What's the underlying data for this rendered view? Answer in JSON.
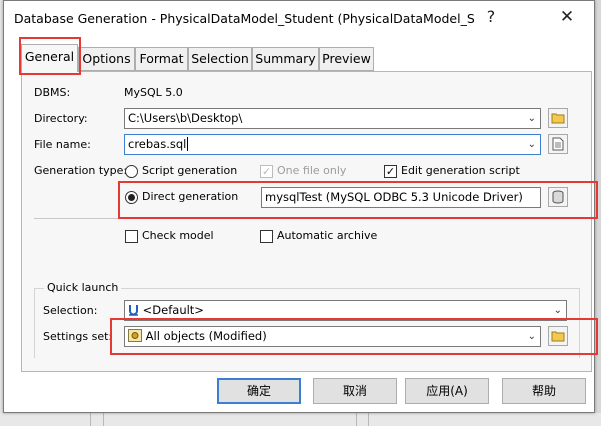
{
  "window": {
    "title": "Database Generation - PhysicalDataModel_Student (PhysicalDataModel_St...",
    "help_symbol": "?",
    "close_symbol": "✕"
  },
  "tabs": [
    {
      "label": "General",
      "active": true
    },
    {
      "label": "Options"
    },
    {
      "label": "Format"
    },
    {
      "label": "Selection"
    },
    {
      "label": "Summary"
    },
    {
      "label": "Preview"
    }
  ],
  "general": {
    "dbms_label": "DBMS:",
    "dbms_value": "MySQL 5.0",
    "directory_label": "Directory:",
    "directory_value": "C:\\Users\\b\\Desktop\\",
    "filename_label": "File name:",
    "filename_value": "crebas.sql",
    "gentype_label": "Generation type:",
    "script_generation": "Script generation",
    "one_file_only": "One file only",
    "edit_generation_script": "Edit generation script",
    "direct_generation": "Direct generation",
    "datasource_value": "mysqlTest (MySQL ODBC 5.3 Unicode Driver)",
    "check_model": "Check model",
    "automatic_archive": "Automatic archive"
  },
  "quick_launch": {
    "legend": "Quick launch",
    "selection_label": "Selection:",
    "selection_value": "<Default>",
    "settings_label": "Settings set:",
    "settings_value": "All objects (Modified)"
  },
  "buttons": {
    "ok": "确定",
    "cancel": "取消",
    "apply": "应用(A)",
    "help": "帮助"
  },
  "state": {
    "script_generation_selected": false,
    "direct_generation_selected": true,
    "one_file_only_checked": true,
    "one_file_only_enabled": false,
    "edit_generation_script_checked": true,
    "check_model_checked": false,
    "automatic_archive_checked": false
  },
  "colors": {
    "highlight_red": "#e53935",
    "default_button_border": "#3c7fd0",
    "selection_icon_blue": "#1f5fbf"
  }
}
